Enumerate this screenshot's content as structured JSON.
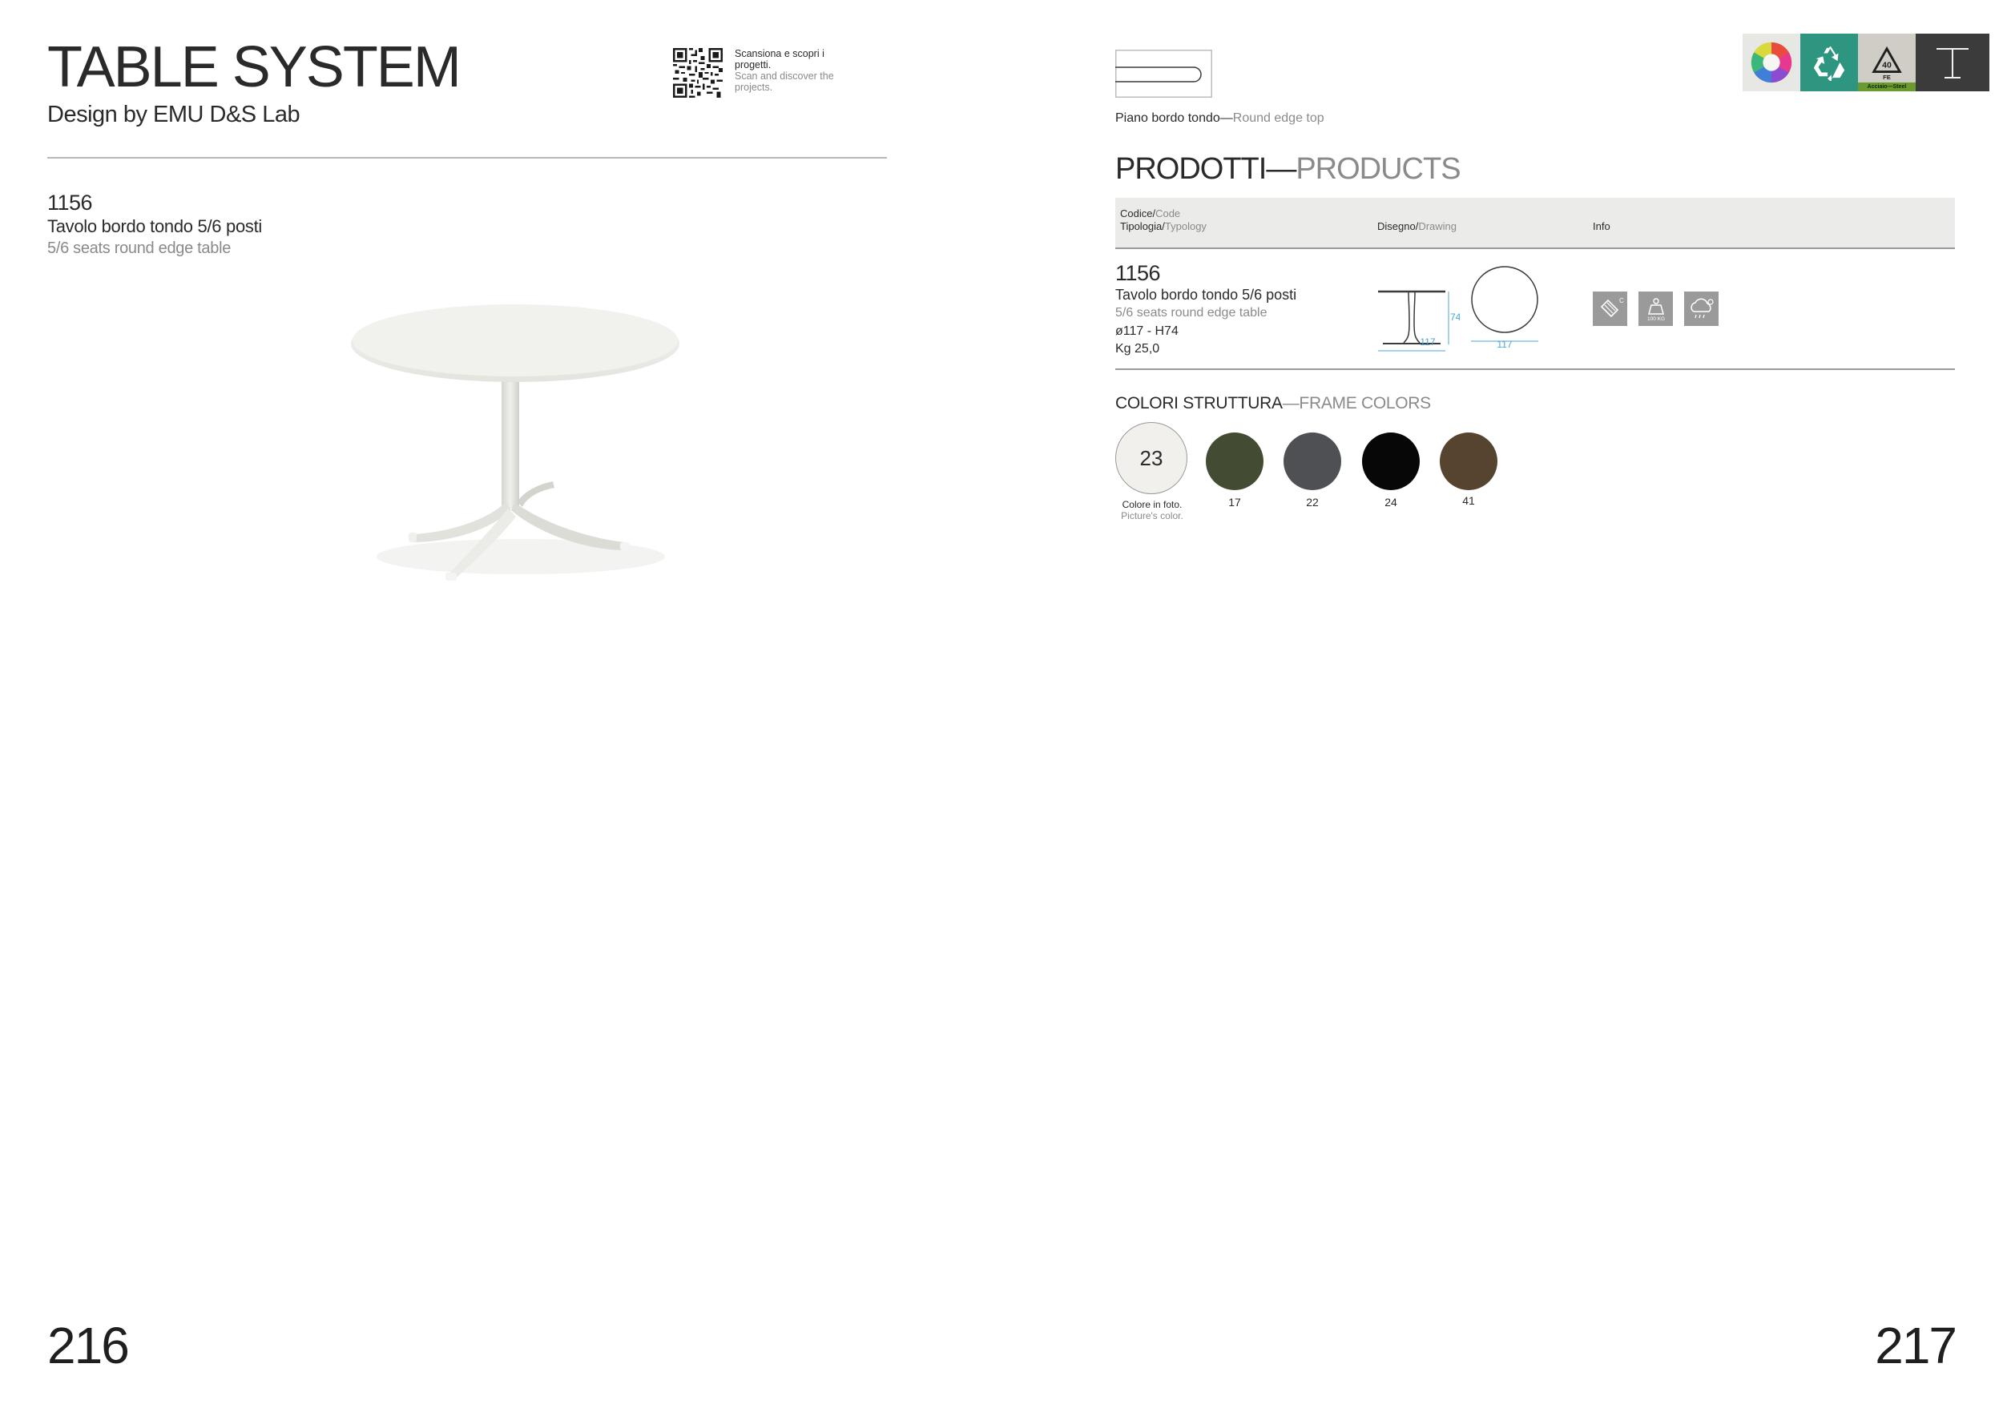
{
  "left_page": {
    "title": "TABLE SYSTEM",
    "designer": "Design by EMU D&S Lab",
    "qr": {
      "text_it": "Scansiona e scopri i progetti.",
      "text_en": "Scan and discover the projects."
    },
    "product": {
      "code": "1156",
      "name_it": "Tavolo bordo tondo 5/6 posti",
      "name_en": "5/6 seats round edge table"
    },
    "page_number": "216"
  },
  "right_page": {
    "edge_caption_it": "Piano bordo tondo",
    "edge_caption_sep": "—",
    "edge_caption_en": "Round edge top",
    "badges": [
      "color-wheel-icon",
      "recycle-icon",
      "steel-recycling-icon",
      "table-system-icon"
    ],
    "steel_badge_label": "Acciaio—Steel",
    "steel_badge_number": "40",
    "steel_badge_code": "FE",
    "products_heading_it": "PRODOTTI",
    "products_heading_sep": "—",
    "products_heading_en": "PRODUCTS",
    "table_header": {
      "code_it": "Codice/",
      "code_en": "Code",
      "typology_it": "Tipologia/",
      "typology_en": "Typology",
      "drawing_it": "Disegno/",
      "drawing_en": "Drawing",
      "info": "Info"
    },
    "row": {
      "code": "1156",
      "name_it": "Tavolo bordo tondo 5/6 posti",
      "name_en": "5/6 seats round edge table",
      "dimensions": "ø117 - H74",
      "weight": "Kg 25,0",
      "drawing_height": "74",
      "drawing_width": "117",
      "drawing_diameter": "117",
      "info_icons": [
        "anti-scratch-icon",
        "load-capacity-icon",
        "weather-resistant-icon"
      ],
      "load_label": "100 KG"
    },
    "frame_colors_heading_it": "COLORI STRUTTURA",
    "frame_colors_heading_sep": "—",
    "frame_colors_heading_en": "FRAME COLORS",
    "frame_colors": [
      {
        "code": "23",
        "hex": "#f1f0ec"
      },
      {
        "code": "17",
        "hex": "#434c33"
      },
      {
        "code": "22",
        "hex": "#4e5054"
      },
      {
        "code": "24",
        "hex": "#070707"
      },
      {
        "code": "41",
        "hex": "#574430"
      }
    ],
    "photo_color_it": "Colore in foto.",
    "photo_color_en": "Picture's color.",
    "page_number": "217"
  }
}
